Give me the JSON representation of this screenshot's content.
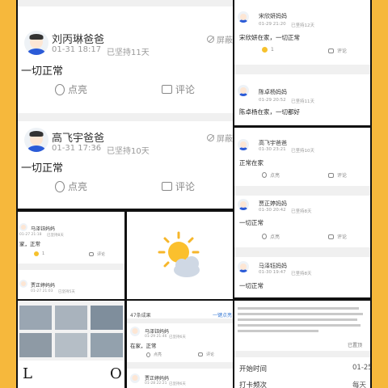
{
  "panel1": {
    "posts": [
      {
        "name": "刘丙琳爸爸",
        "date": "01-31 18:17",
        "streak": "已坚持11天",
        "block": "屏蔽",
        "message": "一切正常",
        "like": "点亮",
        "comment": "评论"
      },
      {
        "name": "高飞宇爸爸",
        "date": "01-31 17:36",
        "streak": "已坚持10天",
        "block": "屏蔽",
        "message": "一切正常",
        "like": "点亮",
        "comment": "评论"
      }
    ]
  },
  "panel2": {
    "posts": [
      {
        "name": "宋欣妍妈妈",
        "date": "01-29 21:20",
        "streak": "已坚持12天",
        "message": "宋欣妍在家，一切正常",
        "like_count": "1",
        "comment": "评论"
      },
      {
        "name": "陈卓杨妈妈",
        "date": "01-29 20:52",
        "streak": "已坚持11天",
        "message": "陈卓杨在家，一切都好"
      }
    ]
  },
  "panel3": {
    "posts": [
      {
        "name": "高飞宇爸爸",
        "date": "01-30 23:21",
        "streak": "已坚持10天",
        "message": "正常在家",
        "like": "点亮",
        "comment": "评论"
      },
      {
        "name": "贾正婷妈妈",
        "date": "01-30 20:42",
        "streak": "已坚持8天",
        "message": "一切正常",
        "like": "点亮",
        "comment": "评论"
      },
      {
        "name": "马泽钰妈妈",
        "date": "01-30 19:47",
        "streak": "已坚持8天",
        "message": "一切正常"
      }
    ]
  },
  "panel4": {
    "posts": [
      {
        "name": "马泽钰妈妈",
        "date": "01-27 21:18",
        "streak": "已坚持8天",
        "message": "家，正常",
        "like_count": "1",
        "comment": "评论"
      },
      {
        "name": "贾正婷妈妈",
        "date": "01-27 21:03",
        "streak": "已坚持5天"
      }
    ]
  },
  "panel6": {
    "letters": [
      "L",
      "O"
    ]
  },
  "panel7": {
    "count": "47条成果",
    "link": "一键点亮",
    "posts": [
      {
        "name": "马泽钰妈妈",
        "date": "01-29 21:46",
        "streak": "已坚持6天",
        "message": "在家，正常",
        "like": "点亮",
        "comment": "评论"
      },
      {
        "name": "贾正婷妈妈",
        "date": "01-28 22:21",
        "streak": "已坚持6天"
      }
    ]
  },
  "panel8": {
    "tag": "已置顶",
    "rows": [
      {
        "label": "开始时间",
        "value": "01-25"
      },
      {
        "label": "打卡频次",
        "value": "每天"
      }
    ]
  },
  "colors": {
    "frame": "#f6b83c",
    "accent": "#f6c12d"
  }
}
